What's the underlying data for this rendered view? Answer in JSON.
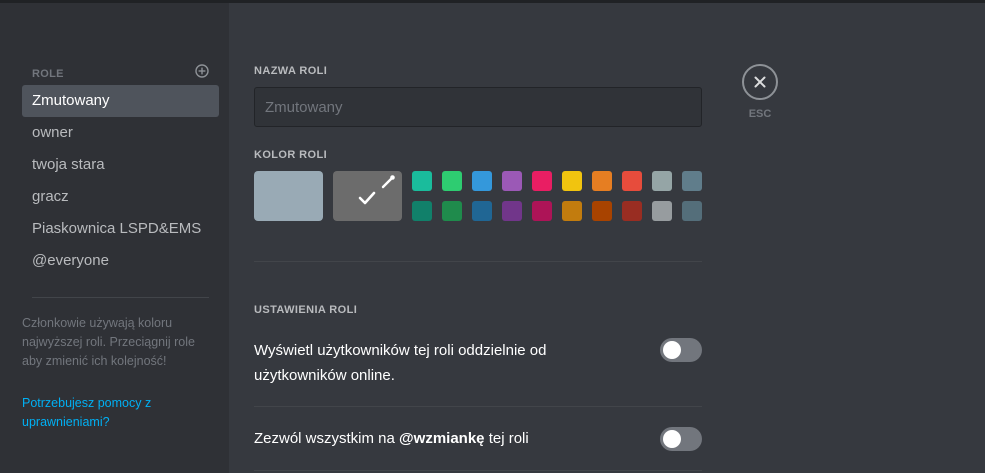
{
  "sidebar": {
    "header": "ROLE",
    "add_icon": "plus-circle-icon",
    "roles": [
      {
        "label": "Zmutowany",
        "selected": true
      },
      {
        "label": "owner",
        "selected": false
      },
      {
        "label": "twoja stara",
        "selected": false
      },
      {
        "label": "gracz",
        "selected": false
      },
      {
        "label": "Piaskownica LSPD&EMS",
        "selected": false
      },
      {
        "label": "@everyone",
        "selected": false
      }
    ],
    "note": "Członkowie używają koloru najwyższej roli. Przeciągnij role aby zmienić ich kolejność!",
    "help_link": "Potrzebujesz pomocy z uprawnieniami?"
  },
  "role_name": {
    "label": "NAZWA ROLI",
    "placeholder": "Zmutowany",
    "value": ""
  },
  "role_color": {
    "label": "KOLOR ROLI",
    "default_color": "#99aab5",
    "custom_color": "#6c6c6c",
    "custom_icons": [
      "check-icon",
      "eyedropper-icon"
    ],
    "row1": [
      "#1abc9c",
      "#2ecc71",
      "#3498db",
      "#9b59b6",
      "#e91e63",
      "#f1c40f",
      "#e67e22",
      "#e74c3c",
      "#95a5a6",
      "#607d8b"
    ],
    "row2": [
      "#11806a",
      "#1f8b4c",
      "#206694",
      "#71368a",
      "#ad1457",
      "#c27c0e",
      "#a84300",
      "#992d22",
      "#979c9f",
      "#546e7a"
    ]
  },
  "role_settings": {
    "label": "USTAWIENIA ROLI",
    "items": [
      {
        "text": "Wyświetl użytkowników tej roli oddzielnie od użytkowników online.",
        "enabled": false
      },
      {
        "text_before": "Zezwól wszystkim na ",
        "text_bold": "@wzmiankę",
        "text_after": " tej roli",
        "enabled": false
      }
    ]
  },
  "close": {
    "icon": "close-icon",
    "label": "ESC"
  },
  "colors": {
    "sidebar_bg": "#2f3136",
    "main_bg": "#36393f",
    "selected_bg": "#4f545c",
    "link": "#00b0f4",
    "toggle_off": "#72767d"
  }
}
